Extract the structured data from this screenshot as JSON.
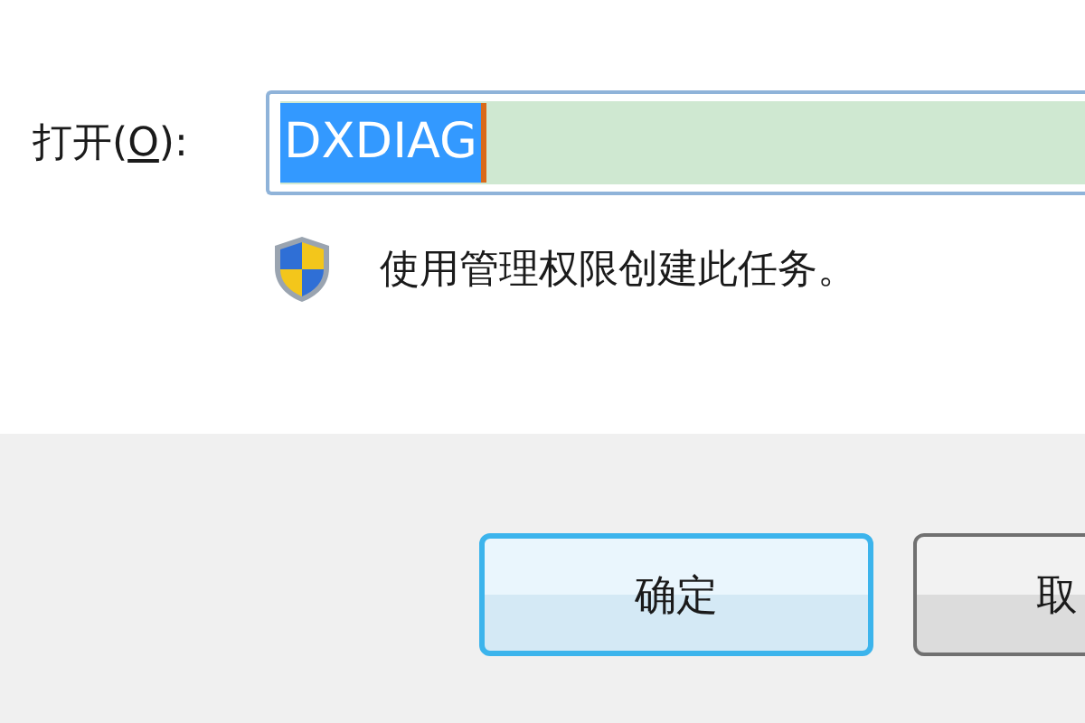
{
  "open_field": {
    "label_prefix": "打开(",
    "mnemonic": "O",
    "label_suffix": "):",
    "value": "DXDIAG",
    "selected": true
  },
  "admin_note": {
    "text": "使用管理权限创建此任务。"
  },
  "buttons": [
    {
      "label": "确定",
      "default": true
    },
    {
      "label": "取",
      "default": false
    }
  ]
}
